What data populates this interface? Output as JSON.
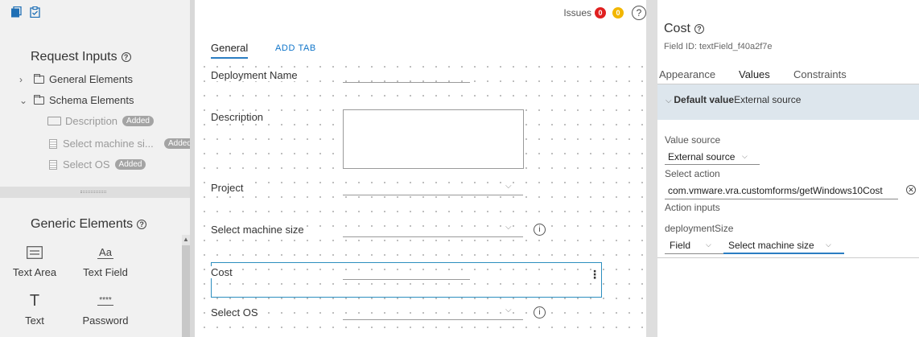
{
  "left": {
    "request_inputs_title": "Request Inputs",
    "tree": [
      {
        "label": "General Elements",
        "expanded": false
      },
      {
        "label": "Schema Elements",
        "expanded": true
      }
    ],
    "schema_children": [
      {
        "label": "Description",
        "badge": "Added",
        "icon": "text-field-icon"
      },
      {
        "label": "Select machine si...",
        "badge": "Added",
        "icon": "dropdown-icon"
      },
      {
        "label": "Select OS",
        "badge": "Added",
        "icon": "dropdown-icon"
      }
    ],
    "generic_elements_title": "Generic Elements",
    "generic_items": [
      {
        "label": "Text Area",
        "icon_text": ""
      },
      {
        "label": "Text Field",
        "icon_text": "Aa"
      },
      {
        "label": "Text",
        "icon_text": "T"
      },
      {
        "label": "Password",
        "icon_text": "****"
      }
    ]
  },
  "canvas": {
    "issues_label": "Issues",
    "issues_error_count": "0",
    "issues_warning_count": "0",
    "issues_help": "?",
    "tabs": {
      "general": "General",
      "add_tab": "ADD TAB"
    },
    "fields": {
      "deployment_name": "Deployment Name",
      "description": "Description",
      "project": "Project",
      "select_machine_size": "Select machine size",
      "cost": "Cost",
      "select_os": "Select OS"
    },
    "cost_menu": "⋮"
  },
  "right": {
    "title": "Cost",
    "field_id": "Field ID: textField_f40a2f7e",
    "tabs": {
      "appearance": "Appearance",
      "values": "Values",
      "constraints": "Constraints"
    },
    "default_value_label": "Default value",
    "default_value_source": "External source",
    "value_source_label": "Value source",
    "value_source_value": "External source",
    "select_action_label": "Select action",
    "select_action_value": "com.vmware.vra.customforms/getWindows10Cost",
    "action_inputs_label": "Action inputs",
    "param_name": "deploymentSize",
    "param_type": "Field",
    "param_field": "Select machine size"
  },
  "colors": {
    "accent": "#2a7dc2",
    "error": "#e02020",
    "warning": "#f2b600"
  }
}
